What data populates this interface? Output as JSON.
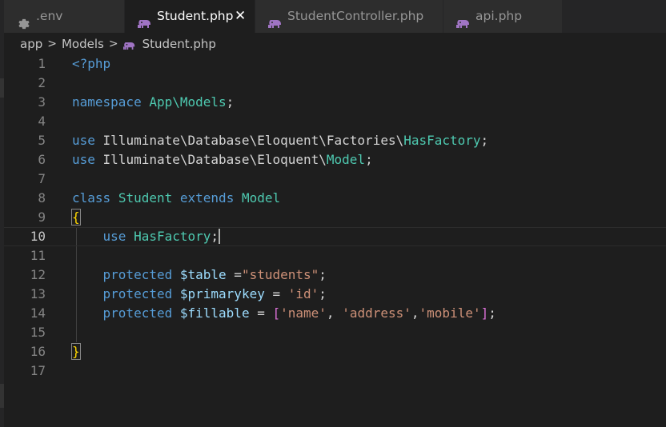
{
  "tabs": [
    {
      "label": ".env",
      "icon": "gear-icon"
    },
    {
      "label": "Student.php",
      "icon": "php-elephant-icon",
      "close": "✕"
    },
    {
      "label": "StudentController.php",
      "icon": "php-elephant-icon"
    },
    {
      "label": "api.php",
      "icon": "php-elephant-icon"
    }
  ],
  "breadcrumb": [
    {
      "label": "app"
    },
    {
      "label": "Models"
    },
    {
      "label": "Student.php",
      "icon": "php-elephant-icon"
    }
  ],
  "breadcrumb_sep": ">",
  "colors": {
    "keyword": "#569cd6",
    "type": "#4ec9b0",
    "string": "#ce9178",
    "variable": "#9cdcfe",
    "plain": "#d4d4d4",
    "bracket": "#ffd700",
    "bracket2": "#da70d6",
    "php_icon": "#a074c4"
  },
  "editor": {
    "current_line": 10,
    "lines": [
      {
        "n": "1",
        "tokens": [
          {
            "t": "<?php",
            "c": "keyword"
          }
        ]
      },
      {
        "n": "2",
        "tokens": []
      },
      {
        "n": "3",
        "tokens": [
          {
            "t": "namespace",
            "c": "keyword"
          },
          {
            "t": " ",
            "c": "plain"
          },
          {
            "t": "App\\Models",
            "c": "type"
          },
          {
            "t": ";",
            "c": "plain"
          }
        ]
      },
      {
        "n": "4",
        "tokens": []
      },
      {
        "n": "5",
        "tokens": [
          {
            "t": "use",
            "c": "keyword"
          },
          {
            "t": " Illuminate\\Database\\Eloquent\\Factories\\",
            "c": "plain"
          },
          {
            "t": "HasFactory",
            "c": "type"
          },
          {
            "t": ";",
            "c": "plain"
          }
        ]
      },
      {
        "n": "6",
        "tokens": [
          {
            "t": "use",
            "c": "keyword"
          },
          {
            "t": " Illuminate\\Database\\Eloquent\\",
            "c": "plain"
          },
          {
            "t": "Model",
            "c": "type"
          },
          {
            "t": ";",
            "c": "plain"
          }
        ]
      },
      {
        "n": "7",
        "tokens": []
      },
      {
        "n": "8",
        "tokens": [
          {
            "t": "class",
            "c": "keyword"
          },
          {
            "t": " ",
            "c": "plain"
          },
          {
            "t": "Student",
            "c": "type"
          },
          {
            "t": " ",
            "c": "plain"
          },
          {
            "t": "extends",
            "c": "keyword"
          },
          {
            "t": " ",
            "c": "plain"
          },
          {
            "t": "Model",
            "c": "type"
          }
        ]
      },
      {
        "n": "9",
        "tokens": [
          {
            "t": "{",
            "c": "bracket",
            "boxed": true
          }
        ]
      },
      {
        "n": "10",
        "tokens": [
          {
            "t": "    ",
            "c": "plain"
          },
          {
            "t": "use",
            "c": "keyword"
          },
          {
            "t": " ",
            "c": "plain"
          },
          {
            "t": "HasFactory",
            "c": "type"
          },
          {
            "t": ";",
            "c": "plain"
          }
        ],
        "cursor": true
      },
      {
        "n": "11",
        "tokens": []
      },
      {
        "n": "12",
        "tokens": [
          {
            "t": "    ",
            "c": "plain"
          },
          {
            "t": "protected",
            "c": "keyword"
          },
          {
            "t": " ",
            "c": "plain"
          },
          {
            "t": "$table",
            "c": "variable"
          },
          {
            "t": " =",
            "c": "plain"
          },
          {
            "t": "\"students\"",
            "c": "string"
          },
          {
            "t": ";",
            "c": "plain"
          }
        ]
      },
      {
        "n": "13",
        "tokens": [
          {
            "t": "    ",
            "c": "plain"
          },
          {
            "t": "protected",
            "c": "keyword"
          },
          {
            "t": " ",
            "c": "plain"
          },
          {
            "t": "$primarykey",
            "c": "variable"
          },
          {
            "t": " = ",
            "c": "plain"
          },
          {
            "t": "'id'",
            "c": "string"
          },
          {
            "t": ";",
            "c": "plain"
          }
        ]
      },
      {
        "n": "14",
        "tokens": [
          {
            "t": "    ",
            "c": "plain"
          },
          {
            "t": "protected",
            "c": "keyword"
          },
          {
            "t": " ",
            "c": "plain"
          },
          {
            "t": "$fillable",
            "c": "variable"
          },
          {
            "t": " = ",
            "c": "plain"
          },
          {
            "t": "[",
            "c": "bracket2"
          },
          {
            "t": "'name'",
            "c": "string"
          },
          {
            "t": ", ",
            "c": "plain"
          },
          {
            "t": "'address'",
            "c": "string"
          },
          {
            "t": ",",
            "c": "plain"
          },
          {
            "t": "'mobile'",
            "c": "string"
          },
          {
            "t": "]",
            "c": "bracket2"
          },
          {
            "t": ";",
            "c": "plain"
          }
        ]
      },
      {
        "n": "15",
        "tokens": []
      },
      {
        "n": "16",
        "tokens": [
          {
            "t": "}",
            "c": "bracket",
            "boxed": true
          }
        ]
      },
      {
        "n": "17",
        "tokens": []
      }
    ]
  }
}
